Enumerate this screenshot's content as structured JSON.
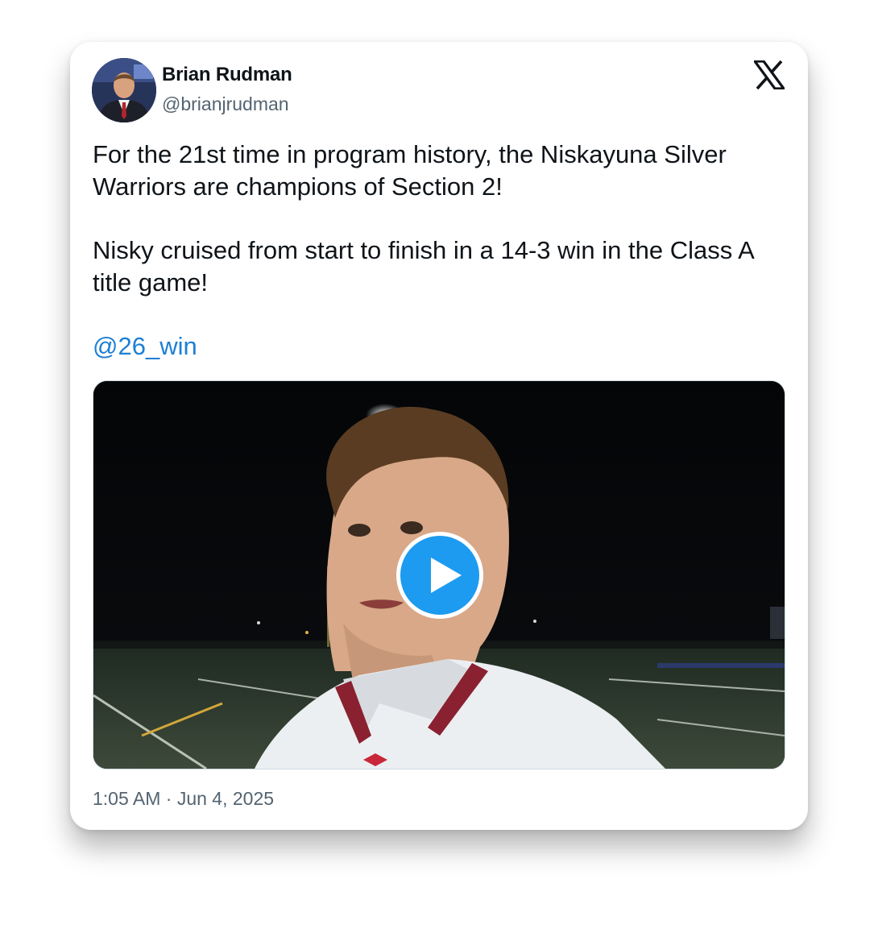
{
  "author": {
    "name": "Brian Rudman",
    "handle": "@brianjrudman",
    "avatar_icon": "profile-photo"
  },
  "brand_icon": "x-logo-icon",
  "tweet": {
    "paragraphs": [
      "For the 21st time in program history, the Niskayuna Silver Warriors are champions of Section 2!",
      "Nisky cruised from start to finish in a 14-3 win in the Class A title game!"
    ],
    "mention": "@26_win"
  },
  "media": {
    "type": "video",
    "play_icon": "play-icon"
  },
  "timestamp": "1:05 AM · Jun 4, 2025",
  "colors": {
    "text": "#0f1419",
    "secondary": "#536471",
    "link": "#1d7fd4",
    "play_button": "#1d9bf0"
  }
}
